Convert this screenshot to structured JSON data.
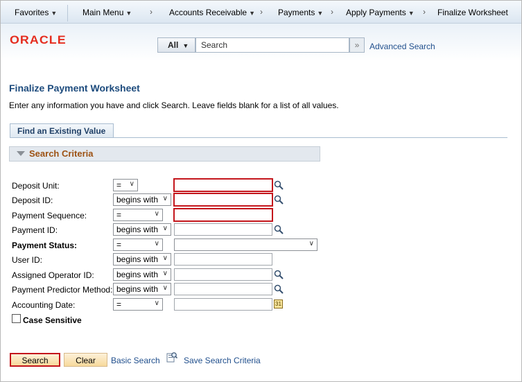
{
  "nav": {
    "favorites": "Favorites",
    "main_menu": "Main Menu",
    "crumbs": [
      "Accounts Receivable",
      "Payments",
      "Apply Payments",
      "Finalize Worksheet"
    ],
    "separator": "›"
  },
  "header": {
    "logo": "ORACLE",
    "search_scope": "All",
    "search_placeholder": "Search",
    "advanced_search": "Advanced Search"
  },
  "page": {
    "title": "Finalize Payment Worksheet",
    "instructions": "Enter any information you have and click Search. Leave fields blank for a list of all values.",
    "tab": "Find an Existing Value",
    "criteria_header": "Search Criteria"
  },
  "criteria": [
    {
      "label": "Deposit Unit:",
      "operator": "=",
      "required": true
    },
    {
      "label": "Deposit ID:",
      "operator": "begins with",
      "required": true
    },
    {
      "label": "Payment Sequence:",
      "operator": "=",
      "required": true
    },
    {
      "label": "Payment ID:",
      "operator": "begins with",
      "required": false
    },
    {
      "label": "Payment Status:",
      "operator": "=",
      "required": false
    },
    {
      "label": "User ID:",
      "operator": "begins with",
      "required": false
    },
    {
      "label": "Assigned Operator ID:",
      "operator": "begins with",
      "required": false
    },
    {
      "label": "Payment Predictor Method:",
      "operator": "begins with",
      "required": false
    },
    {
      "label": "Accounting Date:",
      "operator": "=",
      "required": false
    }
  ],
  "case_sensitive": {
    "label": "Case Sensitive",
    "checked": false
  },
  "actions": {
    "search": "Search",
    "clear": "Clear",
    "basic_search": "Basic Search",
    "save_search": "Save Search Criteria"
  },
  "colors": {
    "brand": "#e52d1f",
    "required_border": "#c4161c",
    "link": "#1f4e8c",
    "title": "#1d4b7d"
  },
  "icons": [
    "caret-down-icon",
    "double-chevron-icon",
    "magnifier-icon",
    "calendar-icon",
    "save-search-icon"
  ]
}
